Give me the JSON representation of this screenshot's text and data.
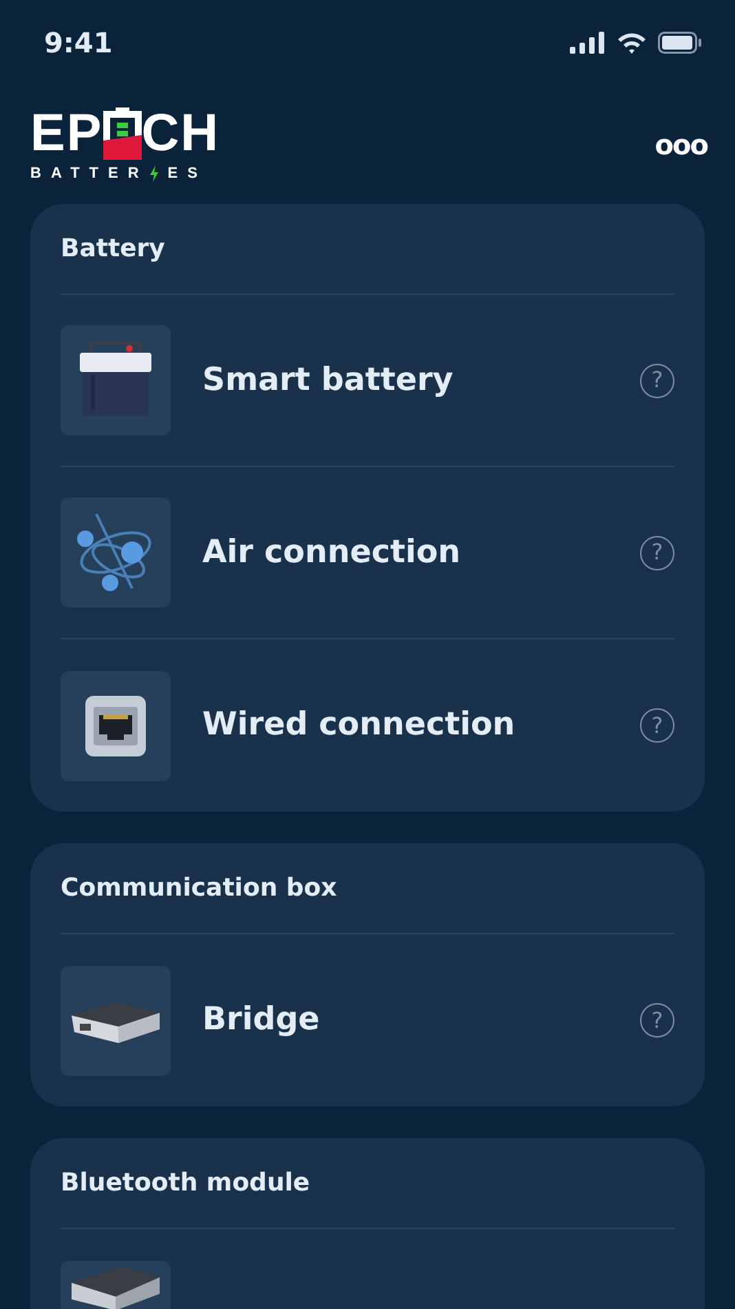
{
  "status_bar": {
    "time": "9:41"
  },
  "logo": {
    "word_start": "EP",
    "word_end": "CH",
    "sub_start": "BATTER",
    "sub_end": "ES"
  },
  "menu_glyph": "ooo",
  "sections": [
    {
      "title": "Battery",
      "items": [
        {
          "kind": "battery",
          "label": "Smart battery",
          "help": "?"
        },
        {
          "kind": "air",
          "label": "Air connection",
          "help": "?"
        },
        {
          "kind": "wired",
          "label": "Wired connection",
          "help": "?"
        }
      ]
    },
    {
      "title": "Communication box",
      "items": [
        {
          "kind": "bridge",
          "label": "Bridge",
          "help": "?"
        }
      ]
    },
    {
      "title": "Bluetooth module",
      "items": [
        {
          "kind": "module"
        }
      ]
    }
  ]
}
